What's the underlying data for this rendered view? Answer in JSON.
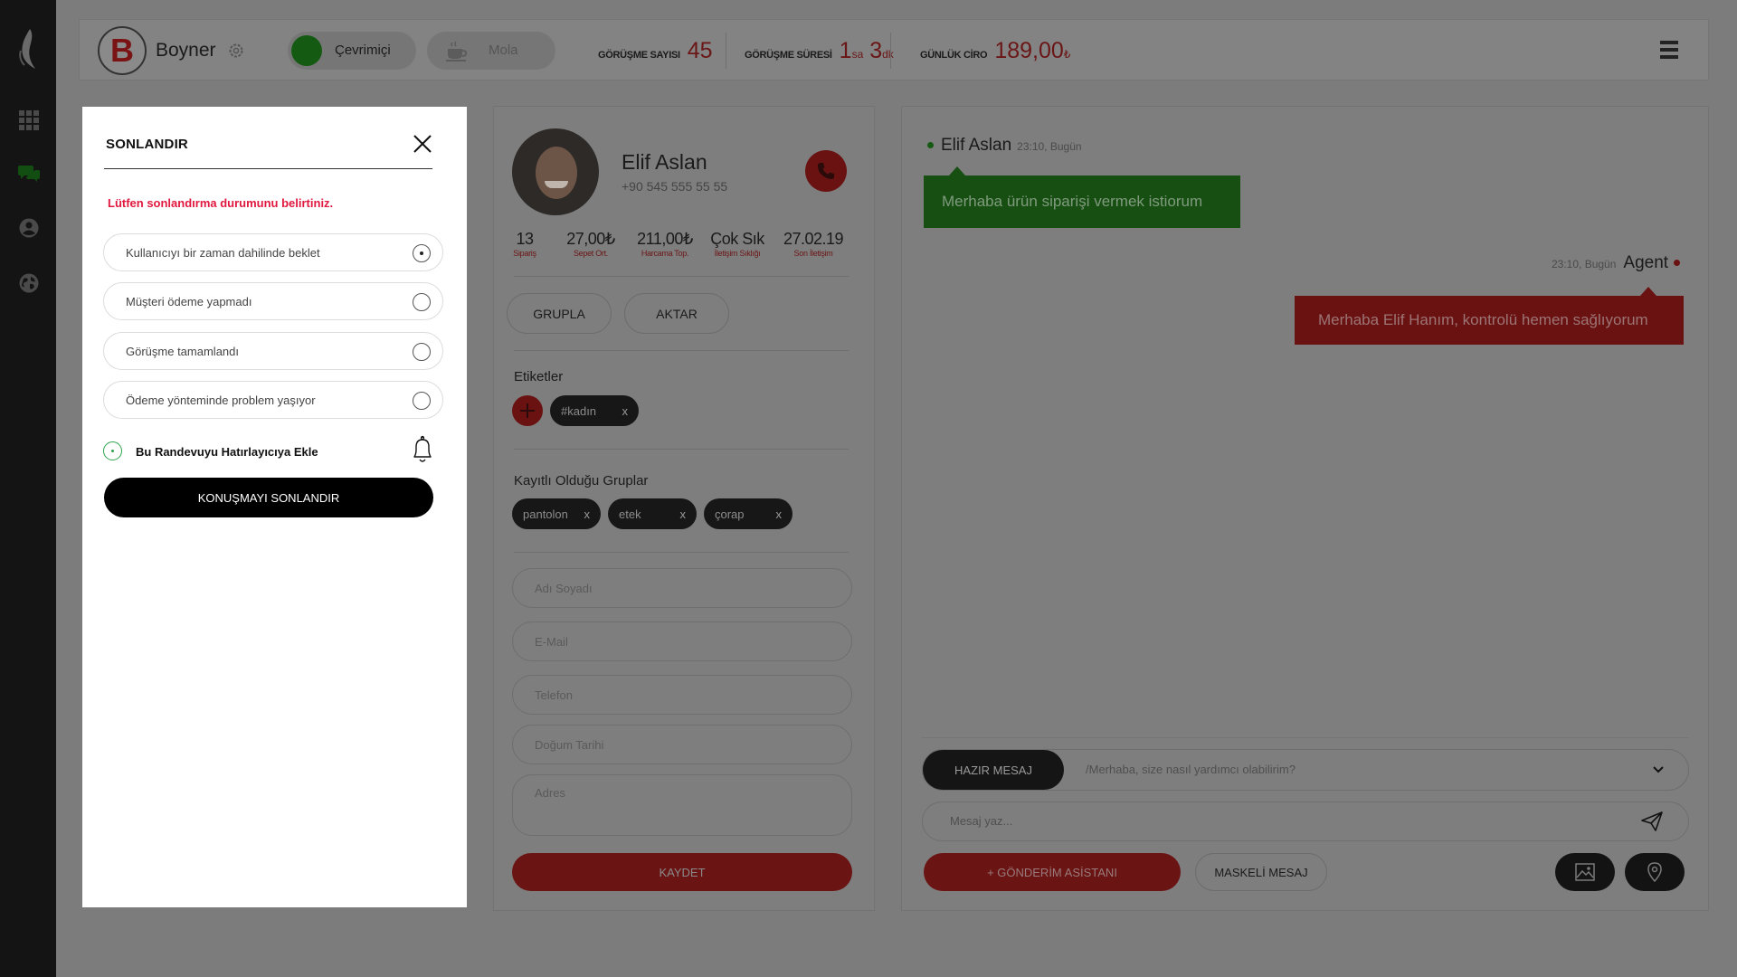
{
  "header": {
    "brand_letter": "B",
    "brand_name": "Boyner",
    "status_label": "Çevrimiçi",
    "break_label": "Mola",
    "stats": {
      "calls_label": "GÖRÜŞME SAYISI",
      "calls_value": "45",
      "duration_label": "GÖRÜŞME SÜRESİ",
      "duration_h": "1",
      "duration_h_unit": "sa",
      "duration_m": "3",
      "duration_m_unit": "dk",
      "revenue_label": "GÜNLÜK CİRO",
      "revenue_value": "189,00",
      "revenue_unit": "₺"
    }
  },
  "customer": {
    "name": "Elif Aslan",
    "phone": "+90 545 555 55 55",
    "kpis": [
      {
        "value": "13",
        "label": "Sipariş"
      },
      {
        "value": "27,00₺",
        "label": "Sepet Ort."
      },
      {
        "value": "211,00₺",
        "label": "Harcama Top."
      },
      {
        "value": "Çok Sık",
        "label": "İletişim Sıklığı"
      },
      {
        "value": "27.02.19",
        "label": "Son İletişim"
      }
    ],
    "group_button": "GRUPLA",
    "transfer_button": "AKTAR",
    "tags_title": "Etiketler",
    "tags": [
      "#kadın"
    ],
    "groups_title": "Kayıtlı Olduğu Gruplar",
    "groups": [
      "pantolon",
      "etek",
      "çorap"
    ],
    "chip_remove": "x",
    "fields": {
      "name_ph": "Adı Soyadı",
      "email_ph": "E-Mail",
      "phone_ph": "Telefon",
      "birth_ph": "Doğum Tarihi",
      "address_ph": "Adres"
    },
    "save_button": "KAYDET"
  },
  "chat": {
    "incoming": {
      "name": "Elif Aslan",
      "time": "23:10, Bugün",
      "text": "Merhaba ürün siparişi vermek istiorum"
    },
    "outgoing": {
      "name": "Agent",
      "time": "23:10, Bugün",
      "text": "Merhaba Elif Hanım, kontrolü hemen sağlıyorum"
    },
    "quick_button": "HAZIR MESAJ",
    "quick_selected": "/Merhaba, size nasıl yardımcı olabilirim?",
    "message_placeholder": "Mesaj yaz...",
    "assistant_button": "+ GÖNDERİM ASİSTANI",
    "masked_button": "MASKELİ MESAJ"
  },
  "modal": {
    "title": "SONLANDIR",
    "warning": "Lütfen sonlandırma durumunu belirtiniz.",
    "options": [
      {
        "label": "Kullanıcıyı bir zaman dahilinde beklet",
        "selected": true
      },
      {
        "label": "Müşteri ödeme yapmadı",
        "selected": false
      },
      {
        "label": "Görüşme tamamlandı",
        "selected": false
      },
      {
        "label": "Ödeme yönteminde problem yaşıyor",
        "selected": false
      }
    ],
    "reminder_label": "Bu Randevuyu Hatırlayıcıya Ekle",
    "end_button": "KONUŞMAYI SONLANDIR"
  },
  "colors": {
    "accent_red": "#d0202e",
    "online_green": "#2ca34c",
    "warning_red": "#e0173e"
  }
}
